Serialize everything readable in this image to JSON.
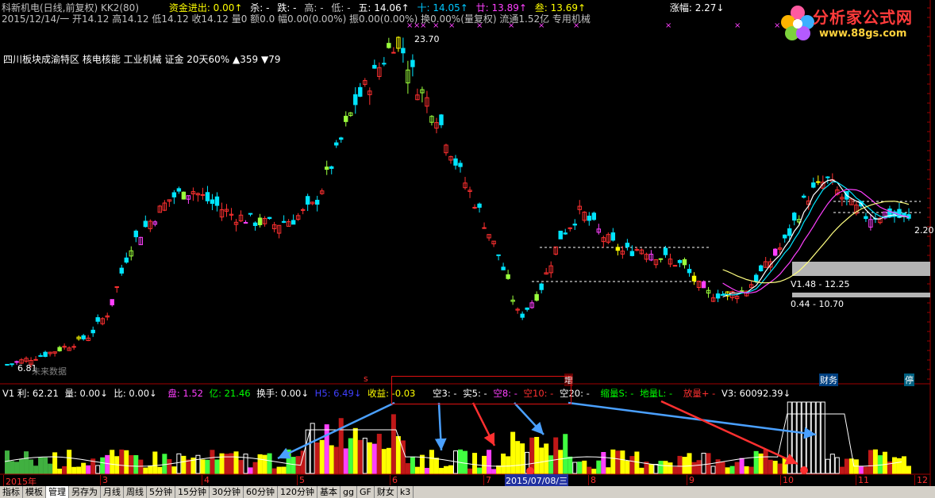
{
  "header": {
    "line1": [
      {
        "text": "科新机电(日线,前复权) KK2(80)",
        "color": "#c0c0c0"
      },
      {
        "text": "资金进出: 0.00↑",
        "color": "#ffff00"
      },
      {
        "text": "杀: -",
        "color": "#ffffff"
      },
      {
        "text": "跌: -",
        "color": "#ffffff"
      },
      {
        "text": "高: -",
        "color": "#c0c0c0"
      },
      {
        "text": "低: -",
        "color": "#c0c0c0"
      },
      {
        "text": "五: 14.06↑",
        "color": "#ffffff"
      },
      {
        "text": "十: 14.05↑",
        "color": "#00c8ff"
      },
      {
        "text": "廿: 13.89↑",
        "color": "#ff40ff"
      },
      {
        "text": "叁: 13.69↑",
        "color": "#ffff00"
      },
      {
        "text": "涨幅: 2.27↓",
        "color": "#ffffff"
      }
    ],
    "line2": "2015/12/14/一 开14.12 高14.12 低14.12 收14.12 量0 额0.0 幅0.00(0.00%) 振0.00(0.00%) 换0.00%(量复权) 流通1.52亿 专用机械",
    "line3": "四川板块成渝特区 核电核能 工业机械 证金 20天60% ▲359 ▼79"
  },
  "watermark": {
    "title": "分析家公式网",
    "url": "www.88gs.com"
  },
  "price_labels": {
    "high": "23.70",
    "band1": "V1.48 - 12.25",
    "band2": "0.44 - 10.70",
    "last": "2.20",
    "bottom_left": "6.81",
    "bottom_tag": "未来数据"
  },
  "markers": {
    "s": "s",
    "zeng": "增",
    "caiwu": "财务",
    "ting": "停"
  },
  "indicator_line": [
    {
      "text": "V1 利: 62.21",
      "color": "#ffffff"
    },
    {
      "text": "量: 0.00↓",
      "color": "#ffffff"
    },
    {
      "text": "比: 0.00↓",
      "color": "#ffffff"
    },
    {
      "text": "盘: 1.52",
      "color": "#ff40ff"
    },
    {
      "text": "亿: 21.46",
      "color": "#00ff00"
    },
    {
      "text": "换手: 0.00↓",
      "color": "#ffffff"
    },
    {
      "text": "H5: 6.49↓",
      "color": "#4040ff"
    },
    {
      "text": "收益: -0.03",
      "color": "#ffff00"
    },
    {
      "text": "空3: -",
      "color": "#ffffff"
    },
    {
      "text": "实5: -",
      "color": "#ffffff"
    },
    {
      "text": "空8: -",
      "color": "#ff40ff"
    },
    {
      "text": "空10: -",
      "color": "#ff3030"
    },
    {
      "text": "空20: -",
      "color": "#ffffff"
    },
    {
      "text": "缩量S: -",
      "color": "#00ff00"
    },
    {
      "text": "地量L: -",
      "color": "#00ff00"
    },
    {
      "text": "放量+ -",
      "color": "#ff3030"
    },
    {
      "text": "V3: 60092.39↓",
      "color": "#ffffff"
    }
  ],
  "date_axis": {
    "labels": [
      "2015年",
      "3",
      "4",
      "5",
      "6",
      "7",
      "8",
      "9",
      "10",
      "11",
      "12"
    ],
    "cursor": "2015/07/08/三"
  },
  "tabs": [
    "指标",
    "模板",
    "管理",
    "另存为",
    "月线",
    "周线",
    "5分钟",
    "15分钟",
    "30分钟",
    "60分钟",
    "120分钟",
    "基本",
    "gg",
    "GF",
    "财女",
    "k3"
  ],
  "active_tab": "管理",
  "chart_data": {
    "type": "candlestick",
    "ylabels_right": [],
    "close_series": [
      6.81,
      7.1,
      7.4,
      7.8,
      8.3,
      9.6,
      12.9,
      14.2,
      15.4,
      15.8,
      15.1,
      14.5,
      14.2,
      14.0,
      14.3,
      15.0,
      17.5,
      20.3,
      21.8,
      23.7,
      21.2,
      19.6,
      16.9,
      14.8,
      12.4,
      9.2,
      10.6,
      13.4,
      14.7,
      13.5,
      12.6,
      12.8,
      12.3,
      11.9,
      10.5,
      10.4,
      10.6,
      11.8,
      13.2,
      15.4,
      16.3,
      15.1,
      14.4,
      14.6,
      14.2
    ]
  }
}
